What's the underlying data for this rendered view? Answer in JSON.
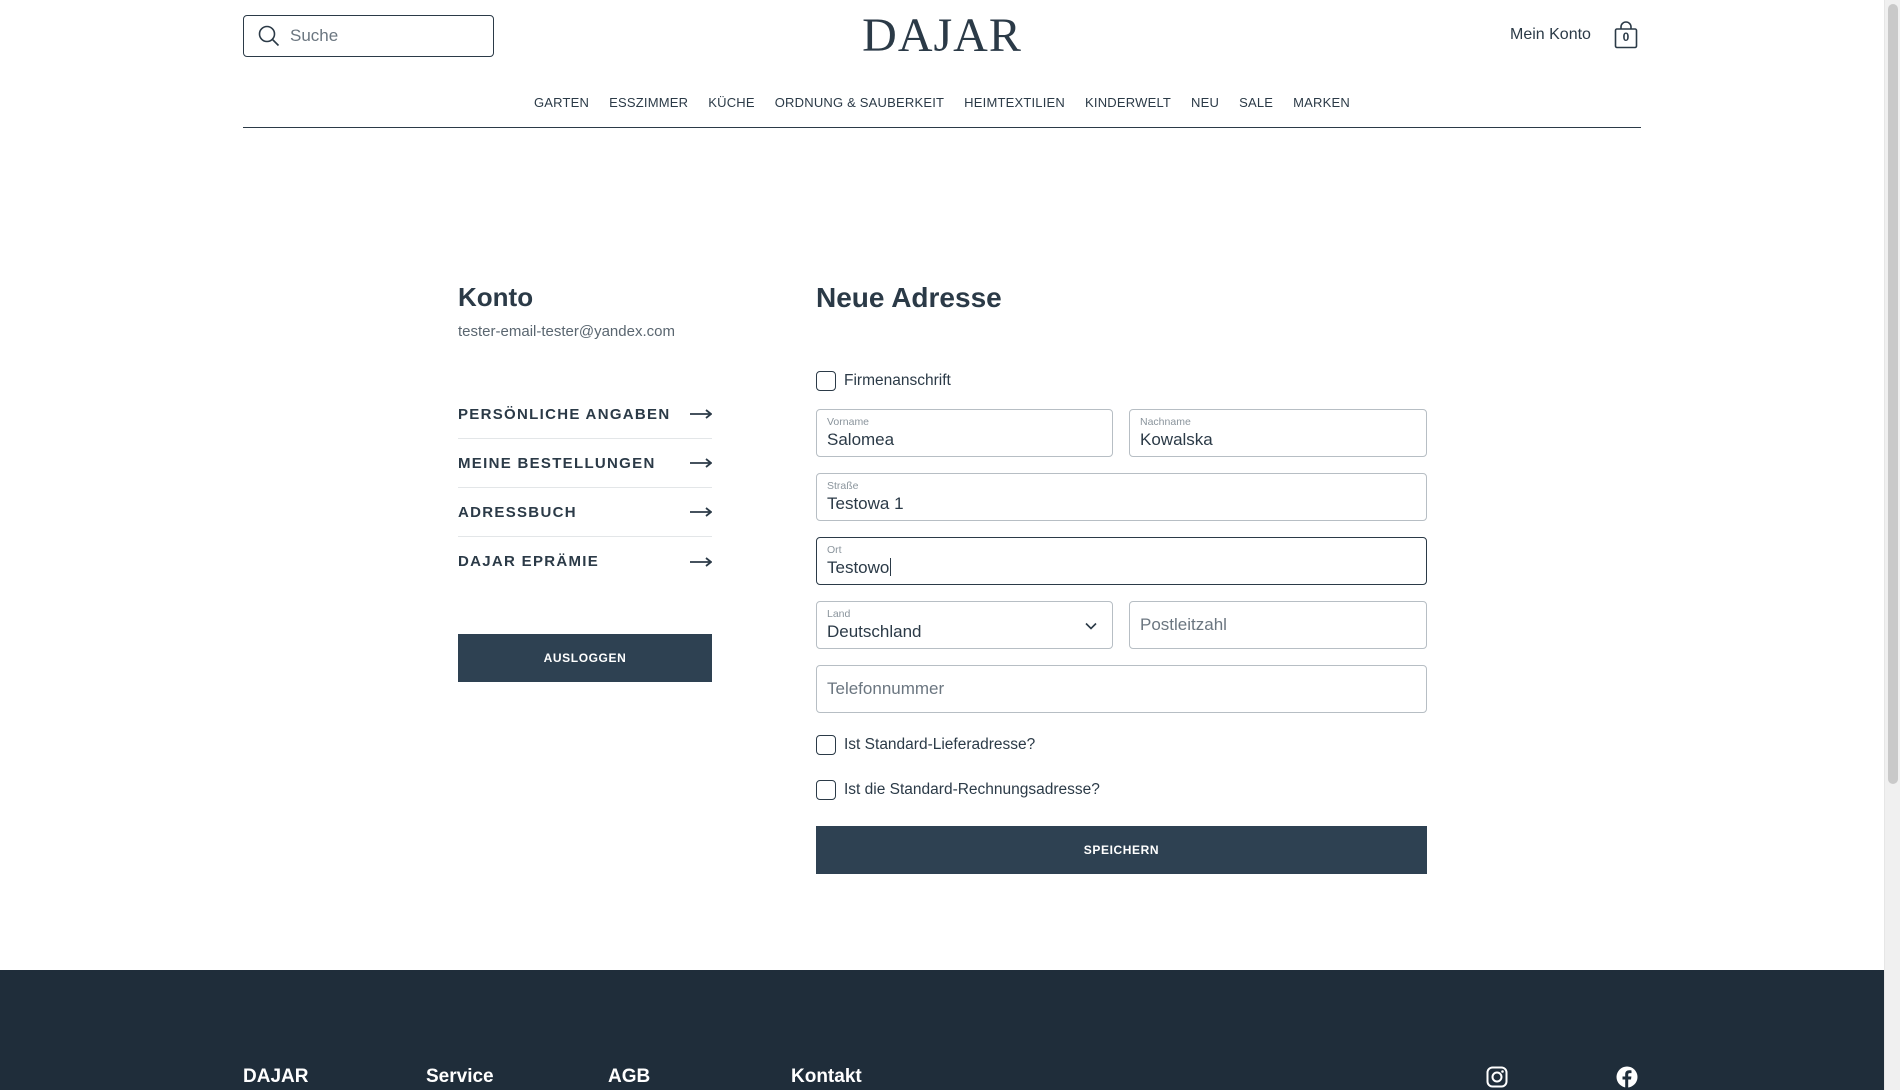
{
  "header": {
    "search_placeholder": "Suche",
    "logo": "DAJAR",
    "account_label": "Mein Konto",
    "cart_count": "0"
  },
  "nav": {
    "items": [
      "GARTEN",
      "ESSZIMMER",
      "KÜCHE",
      "ORDNUNG & SAUBERKEIT",
      "HEIMTEXTILIEN",
      "KINDERWELT",
      "NEU",
      "SALE",
      "MARKEN"
    ]
  },
  "account": {
    "title": "Konto",
    "email": "tester-email-tester@yandex.com",
    "menu": [
      "PERSÖNLICHE ANGABEN",
      "MEINE BESTELLUNGEN",
      "ADRESSBUCH",
      "DAJAR EPRÄMIE"
    ],
    "logout_label": "AUSLOGGEN"
  },
  "form": {
    "title": "Neue Adresse",
    "company_checkbox_label": "Firmenanschrift",
    "company_checked": false,
    "first_name": {
      "label": "Vorname",
      "value": "Salomea"
    },
    "last_name": {
      "label": "Nachname",
      "value": "Kowalska"
    },
    "street": {
      "label": "Straße",
      "value": "Testowa 1"
    },
    "city": {
      "label": "Ort",
      "value": "Testowo"
    },
    "country": {
      "label": "Land",
      "value": "Deutschland"
    },
    "postal_code": {
      "placeholder": "Postleitzahl",
      "value": ""
    },
    "phone": {
      "placeholder": "Telefonnummer",
      "value": ""
    },
    "default_shipping_label": "Ist Standard-Lieferadresse?",
    "default_shipping_checked": false,
    "default_billing_label": "Ist die Standard-Rechnungsadresse?",
    "default_billing_checked": false,
    "save_label": "SPEICHERN"
  },
  "footer": {
    "links": [
      "DAJAR",
      "Service",
      "AGB",
      "Kontakt"
    ],
    "social_icons": [
      "instagram-icon",
      "facebook-icon"
    ]
  },
  "colors": {
    "text": "#2b3a47",
    "button_bg": "#2e4152",
    "footer_bg": "#1f2d3a",
    "border": "#b7bec4"
  }
}
